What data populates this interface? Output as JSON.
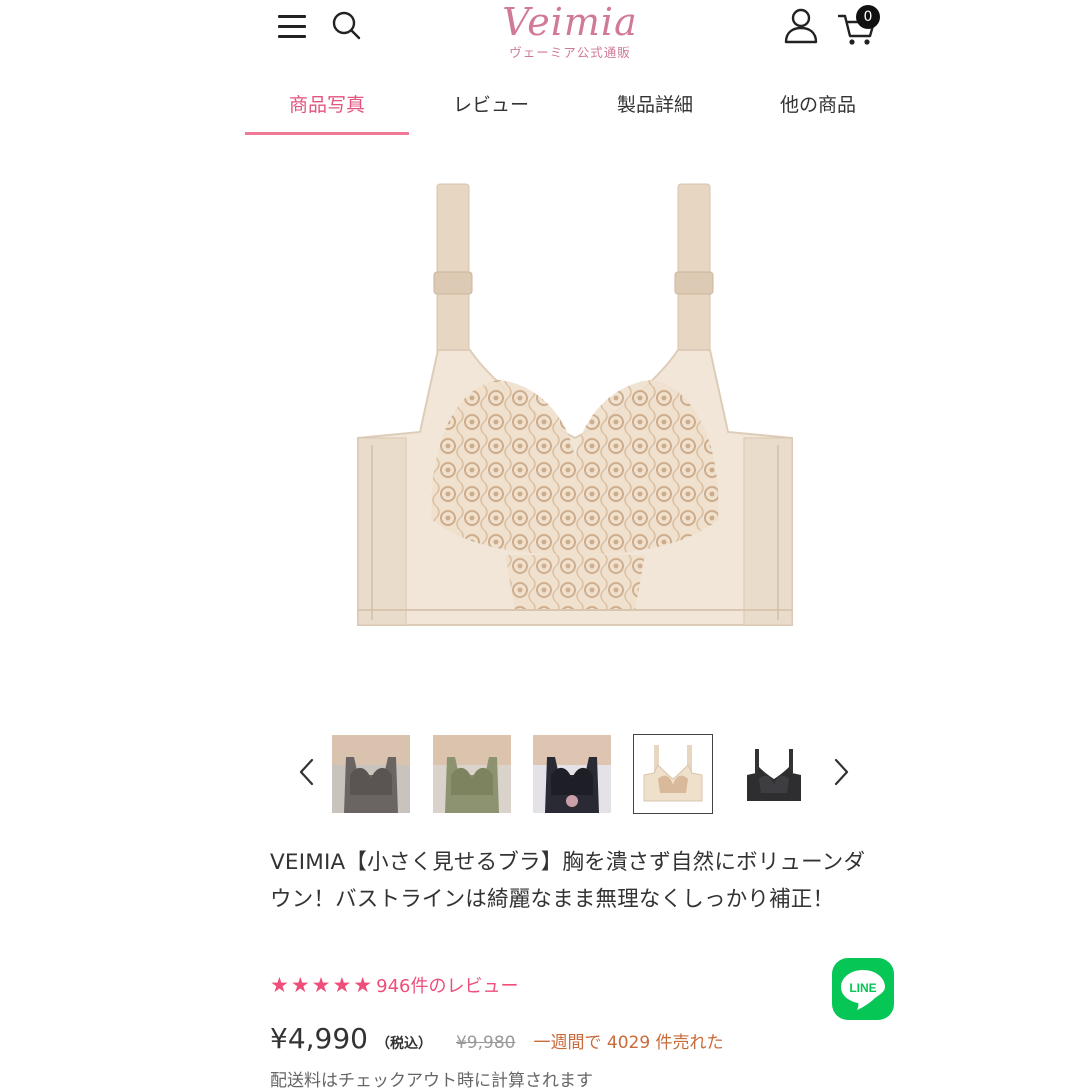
{
  "header": {
    "logo_text": "Veimia",
    "logo_subtext": "ヴェーミア公式通販",
    "cart_count": "0",
    "icons": [
      "menu-icon",
      "search-icon",
      "user-icon",
      "cart-icon"
    ]
  },
  "tabs": [
    {
      "label": "商品写真",
      "active": true
    },
    {
      "label": "レビュー",
      "active": false
    },
    {
      "label": "製品詳細",
      "active": false
    },
    {
      "label": "他の商品",
      "active": false
    }
  ],
  "thumbnails": {
    "count": 5,
    "selected_index": 3,
    "prev_icon": "chevron-left-icon",
    "next_icon": "chevron-right-icon"
  },
  "product": {
    "title": "VEIMIA【小さく見せるブラ】胸を潰さず自然にボリューンダウン！バストラインは綺麗なまま無理なくしっかり補正！",
    "stars": "★★★★★",
    "rating_value": 5,
    "reviews_text": "946件のレビュー",
    "price": "¥4,990",
    "tax_label": "（税込）",
    "original_price": "¥9,980",
    "sold_text": "一週間で 4029 件売れた",
    "shipping_note": "配送料はチェックアウト時に計算されます"
  },
  "line_button": {
    "label": "LINE"
  },
  "colors": {
    "accent": "#ef4e7a",
    "logo": "#d07a98",
    "line_green": "#06c755",
    "sold_text": "#c96a3a"
  }
}
